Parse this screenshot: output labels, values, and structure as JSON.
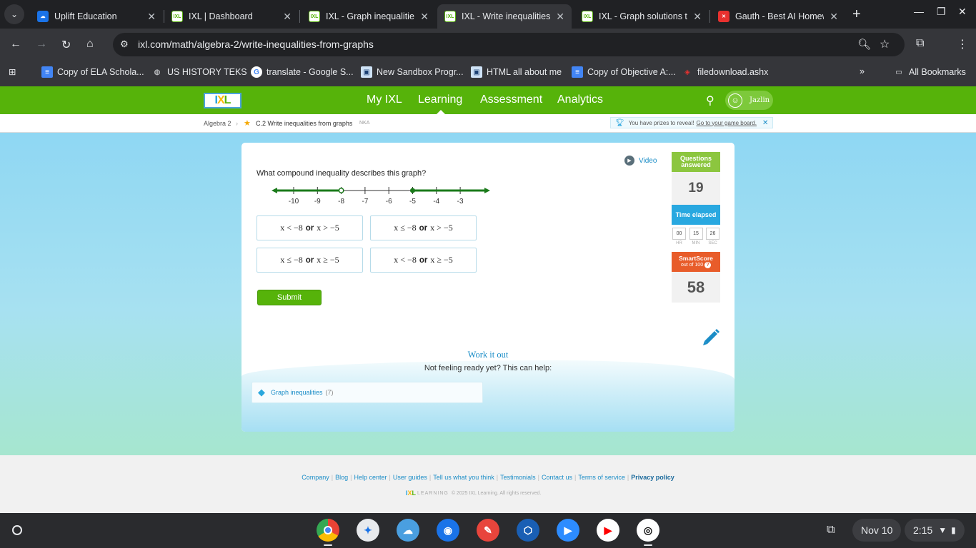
{
  "browser": {
    "tabs": [
      {
        "title": "Uplift Education",
        "fav": "uplift-icon",
        "color": "#1a73e8"
      },
      {
        "title": "IXL | Dashboard",
        "fav": "ixl-icon",
        "color": "#56b30a"
      },
      {
        "title": "IXL - Graph inequalitie",
        "fav": "ixl-icon",
        "color": "#56b30a"
      },
      {
        "title": "IXL - Write inequalities",
        "fav": "ixl-icon",
        "color": "#56b30a",
        "active": true
      },
      {
        "title": "IXL - Graph solutions t",
        "fav": "ixl-icon",
        "color": "#56b30a"
      },
      {
        "title": "Gauth - Best AI Homew",
        "fav": "gauth-icon",
        "color": "#e8312f"
      }
    ],
    "url": "ixl.com/math/algebra-2/write-inequalities-from-graphs",
    "bookmarks": [
      "Copy of ELA Schola...",
      "US HISTORY TEKS",
      "translate - Google S...",
      "New Sandbox Progr...",
      "HTML all about me",
      "Copy of Objective A:...",
      "filedownload.ashx"
    ],
    "all_bookmarks": "All Bookmarks"
  },
  "ixl": {
    "nav": [
      "My IXL",
      "Learning",
      "Assessment",
      "Analytics"
    ],
    "active_nav": "Learning",
    "user": "Jazlin",
    "breadcrumb": {
      "course": "Algebra 2",
      "skill": "C.2 Write inequalities from graphs",
      "code": "NKA"
    },
    "prize_text": "You have prizes to reveal!",
    "prize_link": "Go to your game board.",
    "video_label": "Video",
    "question": "What compound inequality describes this graph?",
    "number_line": {
      "ticks": [
        "-10",
        "-9",
        "-8",
        "-7",
        "-6",
        "-5",
        "-4",
        "-3"
      ],
      "open_point": -8,
      "closed_point": -5
    },
    "choices": [
      {
        "l1": "x < −8",
        "op": "or",
        "l2": "x > −5"
      },
      {
        "l1": "x ≤ −8",
        "op": "or",
        "l2": "x > −5"
      },
      {
        "l1": "x ≤ −8",
        "op": "or",
        "l2": "x ≥ −5"
      },
      {
        "l1": "x < −8",
        "op": "or",
        "l2": "x ≥ −5"
      }
    ],
    "submit": "Submit",
    "work_title": "Work it out",
    "work_sub": "Not feeling ready yet? This can help:",
    "help_link": "Graph inequalities",
    "help_count": "(7)",
    "side": {
      "questions_label": "Questions answered",
      "questions_value": "19",
      "time_label": "Time elapsed",
      "time": {
        "hr": "00",
        "min": "15",
        "sec": "26"
      },
      "time_units": {
        "hr": "HR",
        "min": "MIN",
        "sec": "SEC"
      },
      "smartscore_label": "SmartScore",
      "smartscore_sub": "out of 100",
      "smartscore_value": "58"
    },
    "footer_links": [
      "Company",
      "Blog",
      "Help center",
      "User guides",
      "Tell us what you think",
      "Testimonials",
      "Contact us",
      "Terms of service",
      "Privacy policy"
    ],
    "copyright_brand": "LEARNING",
    "copyright": "© 2025 IXL Learning. All rights reserved."
  },
  "shelf": {
    "date": "Nov 10",
    "time": "2:15"
  },
  "colors": {
    "ixl_green": "#56b30a",
    "ixl_blue": "#1b8dc7",
    "questions_green": "#8cc63f",
    "time_blue": "#29a8e0",
    "smartscore_orange": "#e85c2a"
  }
}
